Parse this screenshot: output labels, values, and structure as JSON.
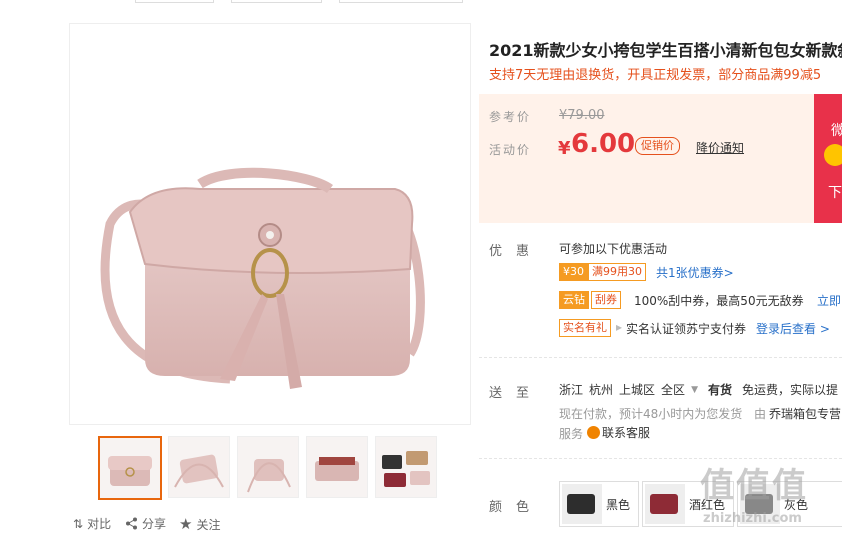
{
  "product": {
    "title": "2021新款少女小挎包学生百搭小清新包包女新款斜",
    "subtitle": "支持7天无理由退换货，开具正规发票，部分商品满99减5"
  },
  "gallery": {
    "actions": {
      "compare": "对比",
      "share": "分享",
      "follow": "关注"
    }
  },
  "price": {
    "ref_label": "参考价",
    "ref_price": "¥79.00",
    "act_label": "活动价",
    "currency": "¥",
    "amount": "6.00",
    "promo_tag": "促销价",
    "notify": "降价通知",
    "accent": "#e4393c"
  },
  "banner": {
    "line1": "微",
    "line2": "下"
  },
  "offers": {
    "label": "优惠",
    "intro": "可参加以下优惠活动",
    "coupon_amount": "¥30",
    "coupon_rule": "满99用30",
    "coupon_link": "共1张优惠券>",
    "diamond_tag": "云钻",
    "scratch_tag": "刮券",
    "scratch_desc": "100%刮中券，最高50元无敌券",
    "scratch_link": "立即",
    "realname_tag": "实名有礼",
    "realname_desc": "实名认证领苏宁支付券",
    "realname_link": "登录后查看 >"
  },
  "delivery": {
    "label": "送至",
    "region": [
      "浙江",
      "杭州",
      "上城区",
      "全区"
    ],
    "stock": "有货",
    "shipping": "免运费，实际以提",
    "note": "现在付款，预计48小时内为您发货",
    "seller_prefix": "由",
    "seller": "乔瑞箱包专营",
    "service_label": "服务",
    "service_link": "联系客服"
  },
  "colors": {
    "label": "颜色",
    "options": [
      "黑色",
      "酒红色",
      "灰色"
    ]
  },
  "watermark": {
    "logo": "值值值",
    "domain": "zhizhizhi.com"
  }
}
